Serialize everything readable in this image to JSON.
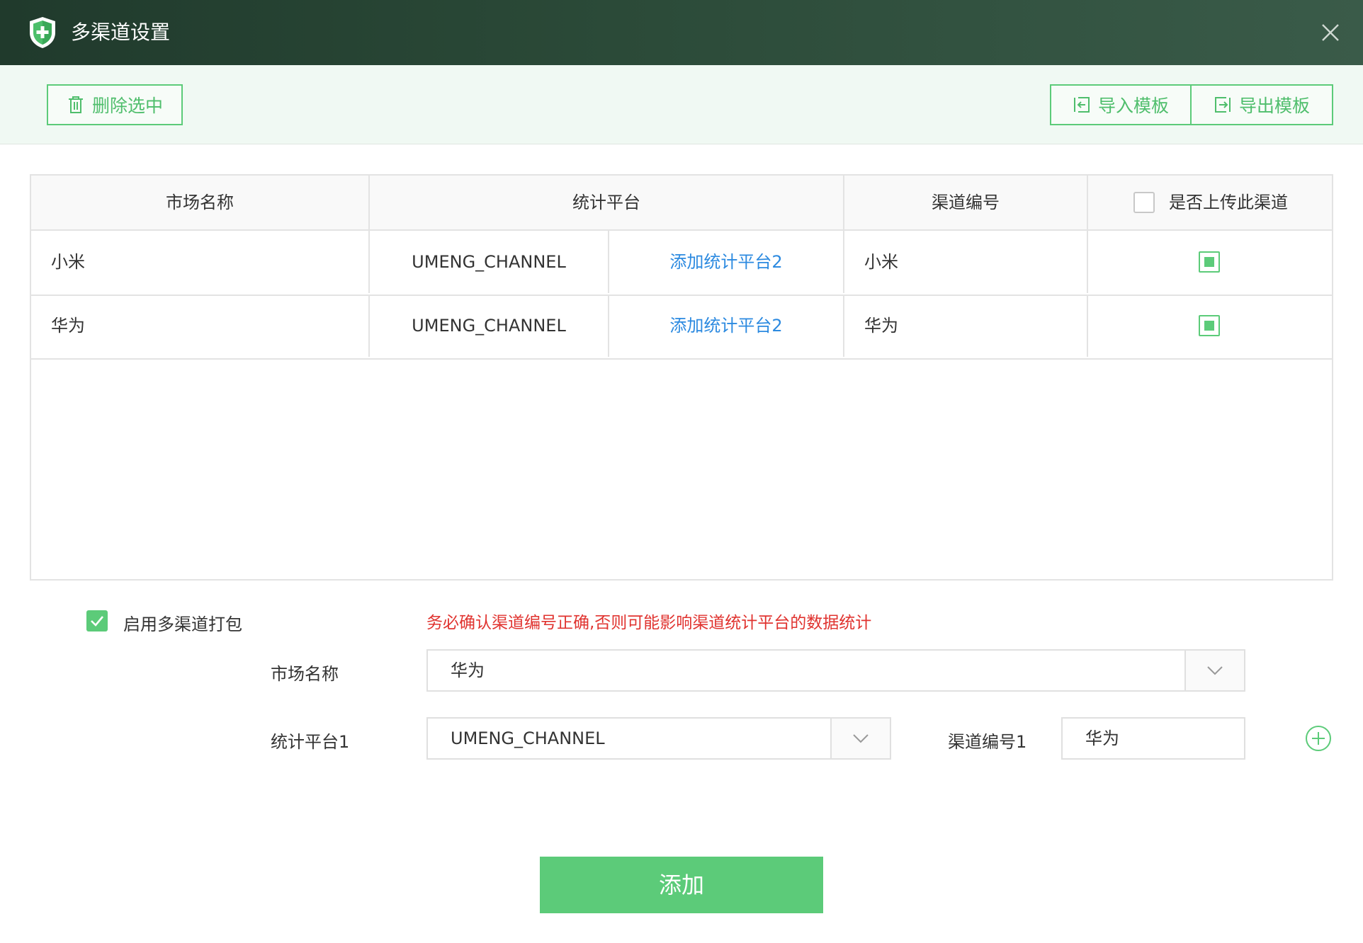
{
  "window": {
    "title": "多渠道设置"
  },
  "toolbar": {
    "delete_label": "删除选中",
    "import_label": "导入模板",
    "export_label": "导出模板"
  },
  "table": {
    "headers": [
      "市场名称",
      "统计平台",
      "渠道编号",
      "是否上传此渠道"
    ],
    "rows": [
      {
        "market": "小米",
        "platform": "UMENG_CHANNEL",
        "add_link": "添加统计平台2",
        "channel": "小米"
      },
      {
        "market": "华为",
        "platform": "UMENG_CHANNEL",
        "add_link": "添加统计平台2",
        "channel": "华为"
      }
    ]
  },
  "form": {
    "enable_label": "启用多渠道打包",
    "warning": "务必确认渠道编号正确,否则可能影响渠道统计平台的数据统计",
    "market_label": "市场名称",
    "market_value": "华为",
    "platform_label": "统计平台1",
    "platform_value": "UMENG_CHANNEL",
    "channel_label": "渠道编号1",
    "channel_value": "华为",
    "add_button": "添加"
  },
  "colors": {
    "accent": "#5ccb79",
    "link": "#2c8ae0",
    "warning": "#e0332f",
    "titlebar": "#2b4a38"
  }
}
